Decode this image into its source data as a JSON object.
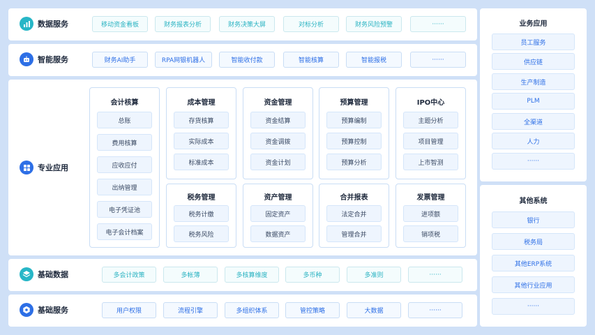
{
  "rows": {
    "data_services": {
      "title": "数据服务",
      "items": [
        "移动资金看板",
        "财务报表分析",
        "财务决策大屏",
        "对标分析",
        "财务风险预警",
        "······"
      ]
    },
    "smart_services": {
      "title": "智能服务",
      "items": [
        "财务AI助手",
        "RPA网银机器人",
        "智能收付款",
        "智能核算",
        "智能报税",
        "······"
      ]
    },
    "professional_apps": {
      "title": "专业应用",
      "groups": [
        {
          "title": "会计核算",
          "items": [
            "总账",
            "费用核算",
            "应收应付",
            "出纳管理",
            "电子凭证池",
            "电子会计档案"
          ]
        },
        {
          "title": "成本管理",
          "items": [
            "存货核算",
            "实际成本",
            "标准成本"
          ]
        },
        {
          "title": "资金管理",
          "items": [
            "资金结算",
            "资金调拨",
            "资金计划"
          ]
        },
        {
          "title": "预算管理",
          "items": [
            "预算编制",
            "预算控制",
            "预算分析"
          ]
        },
        {
          "title": "IPO中心",
          "items": [
            "主题分析",
            "项目管理",
            "上市智测"
          ]
        },
        {
          "title": "税务管理",
          "items": [
            "税务计缴",
            "税务风险"
          ]
        },
        {
          "title": "资产管理",
          "items": [
            "固定资产",
            "数据资产"
          ]
        },
        {
          "title": "合并报表",
          "items": [
            "法定合并",
            "管理合并"
          ]
        },
        {
          "title": "发票管理",
          "items": [
            "进项额",
            "销项税"
          ]
        }
      ]
    },
    "base_data": {
      "title": "基础数据",
      "items": [
        "多会计政策",
        "多帐薄",
        "多核算维度",
        "多币种",
        "多准则",
        "······"
      ]
    },
    "base_services": {
      "title": "基础服务",
      "items": [
        "用户权限",
        "流程引擎",
        "多组织体系",
        "管控策略",
        "大数据",
        "······"
      ]
    }
  },
  "sidebar": {
    "business_apps": {
      "title": "业务应用",
      "items": [
        "员工服务",
        "供应链",
        "生产制造",
        "PLM",
        "全渠道",
        "人力",
        "······"
      ]
    },
    "other_systems": {
      "title": "其他系统",
      "items": [
        "银行",
        "税务局",
        "其他ERP系统",
        "其他行业应用",
        "······"
      ]
    }
  },
  "icons": {
    "data_services": "bar-chart-icon",
    "smart_services": "robot-icon",
    "professional_apps": "grid-icon",
    "base_data": "layers-icon",
    "base_services": "hexagon-gear-icon"
  },
  "colors": {
    "background": "#cfe0f7",
    "accent_blue": "#2d6fe6",
    "accent_teal": "#27b6c7"
  }
}
